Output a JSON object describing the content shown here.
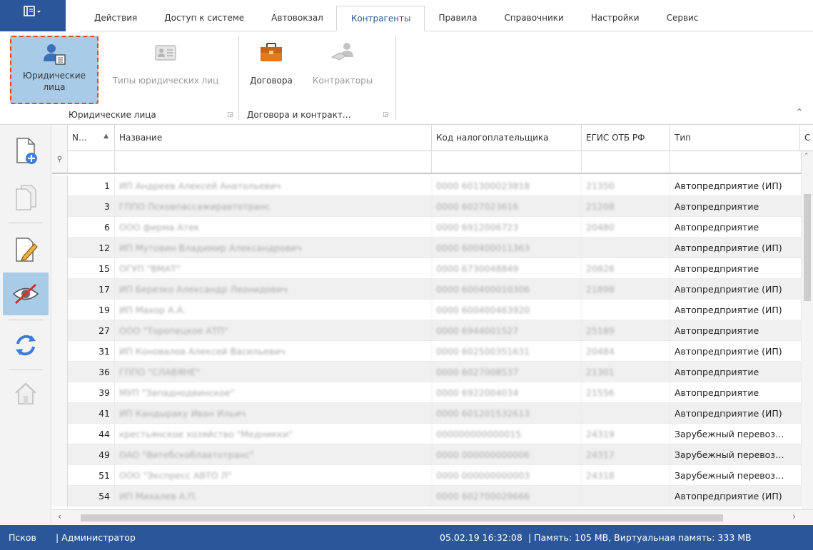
{
  "tabs": [
    "Действия",
    "Доступ к системе",
    "Автовокзал",
    "Контрагенты",
    "Правила",
    "Справочники",
    "Настройки",
    "Сервис"
  ],
  "active_tab": "Контрагенты",
  "ribbon": {
    "btn_legal_line1": "Юридические",
    "btn_legal_line2": "лица",
    "btn_types": "Типы юридических лиц",
    "btn_contracts": "Договора",
    "btn_contractors": "Контракторы",
    "group1": "Юридические лица",
    "group2": "Договора и контракт…"
  },
  "columns": [
    "N…",
    "Название",
    "Код налогоплательщика",
    "ЕГИС ОТБ РФ",
    "Тип",
    "С"
  ],
  "rows": [
    {
      "n": "1",
      "name": "ИП Андреев Алексей Анатольевич",
      "inn": "0000 601300023818",
      "egis": "21350",
      "type": "Автопредприятие (ИП)"
    },
    {
      "n": "3",
      "name": "ГППО Псковпассажиравтотранс",
      "inn": "0000 6027023616",
      "egis": "21208",
      "type": "Автопредприятие"
    },
    {
      "n": "6",
      "name": "ООО фирма Атек",
      "inn": "0000 6912006723",
      "egis": "20480",
      "type": "Автопредприятие"
    },
    {
      "n": "12",
      "name": "ИП Мутовин Владимир Александрович",
      "inn": "0000 600400011363",
      "egis": "",
      "type": "Автопредприятие (ИП)"
    },
    {
      "n": "15",
      "name": "ОГУП \"ВМАТ\"",
      "inn": "0000 6730048849",
      "egis": "20828",
      "type": "Автопредприятие"
    },
    {
      "n": "17",
      "name": "ИП Березко Александр Леонидович",
      "inn": "0000 600400010306",
      "egis": "21898",
      "type": "Автопредприятие (ИП)"
    },
    {
      "n": "19",
      "name": "ИП Махор А.А.",
      "inn": "0000 600400463920",
      "egis": "",
      "type": "Автопредприятие (ИП)"
    },
    {
      "n": "27",
      "name": "ООО \"Торопецкое АТП\"",
      "inn": "0000 6944001527",
      "egis": "25189",
      "type": "Автопредприятие"
    },
    {
      "n": "31",
      "name": "ИП Коновалов Алексей Васильевич",
      "inn": "0000 602500351631",
      "egis": "20484",
      "type": "Автопредприятие (ИП)"
    },
    {
      "n": "36",
      "name": "ГППО \"СЛАВЯНЕ\"",
      "inn": "0000 6027008537",
      "egis": "21301",
      "type": "Автопредприятие"
    },
    {
      "n": "39",
      "name": "МУП \"Западнодвинское\"",
      "inn": "0000 6922004034",
      "egis": "21556",
      "type": "Автопредприятие"
    },
    {
      "n": "41",
      "name": "ИП Кандыраку Иван Ильич",
      "inn": "0000 601201532613",
      "egis": "",
      "type": "Автопредприятие (ИП)"
    },
    {
      "n": "44",
      "name": "крестьянское хозяйство \"Медникки\"",
      "inn": "000000000000015",
      "egis": "24319",
      "type": "Зарубежный перевоз…"
    },
    {
      "n": "49",
      "name": "ОАО \"Витебскоблавтотранс\"",
      "inn": "0000 000000000006",
      "egis": "24317",
      "type": "Зарубежный перевоз…"
    },
    {
      "n": "51",
      "name": "ООО \"Экспресс АВТО Л\"",
      "inn": "0000 000000000003",
      "egis": "24318",
      "type": "Зарубежный перевоз…"
    },
    {
      "n": "54",
      "name": "ИП Михалев А.П.",
      "inn": "0000 602700029666",
      "egis": "",
      "type": "Автопредприятие (ИП)"
    }
  ],
  "status": {
    "city": "Псков",
    "user": "| Администратор",
    "datetime": "05.02.19 16:32:08",
    "memory": "|  Память: 105 MB, Виртуальная память: 333 MB"
  },
  "colors": {
    "accent": "#2b579a",
    "selected": "#a8cce8",
    "focus_border": "#e8470c"
  }
}
